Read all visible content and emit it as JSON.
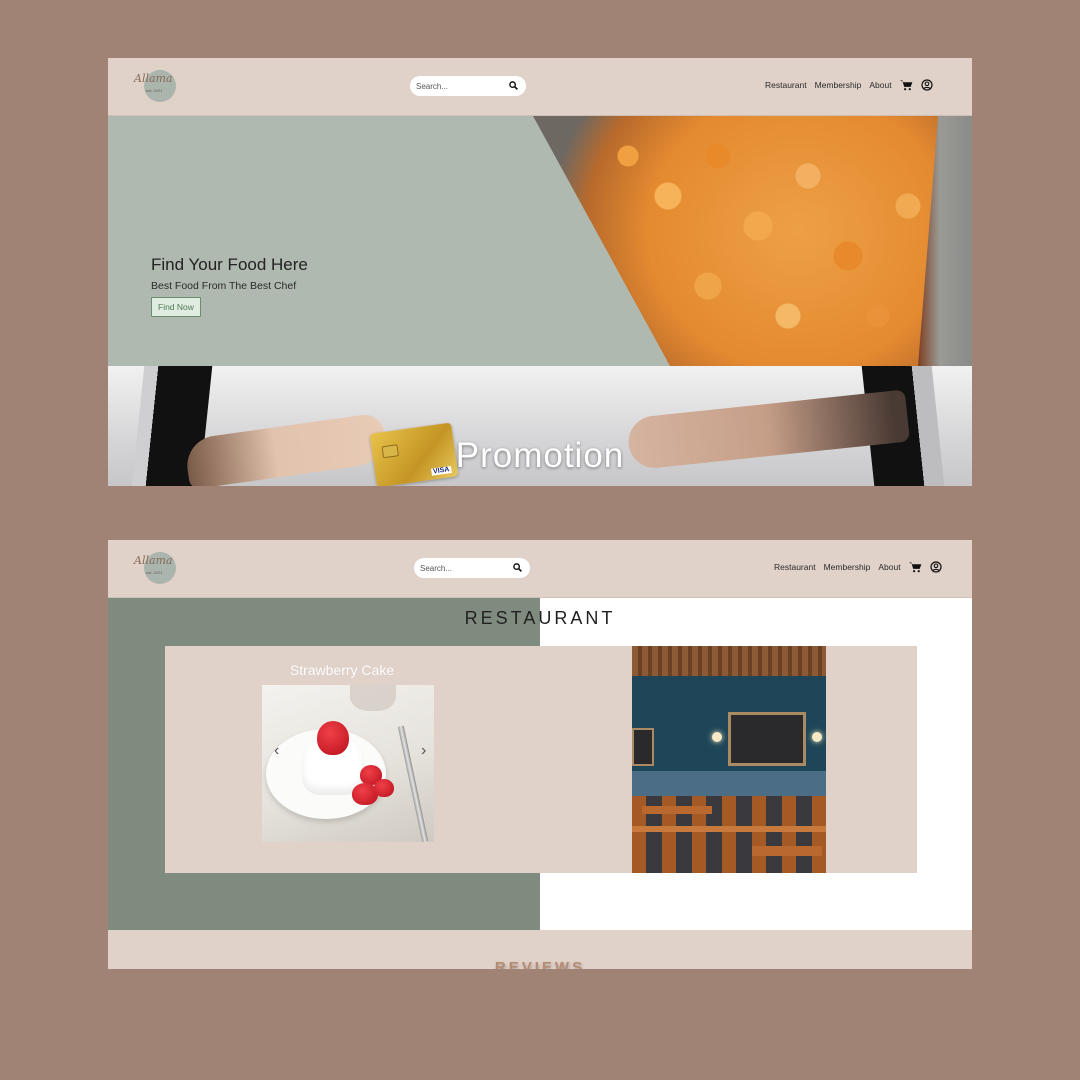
{
  "brand": {
    "logo_text": "Allama",
    "logo_sub": "est. 2021"
  },
  "search": {
    "placeholder": "Search..."
  },
  "nav": {
    "restaurant": "Restaurant",
    "membership": "Membership",
    "about": "About"
  },
  "icons": {
    "search": "search-icon",
    "cart": "cart-icon",
    "account": "user-circle-icon"
  },
  "hero": {
    "title": "Find Your Food Here",
    "subtitle": "Best Food From The Best Chef",
    "button": "Find Now"
  },
  "promo": {
    "title": "Promotion",
    "card_brand": "VISA"
  },
  "restaurant": {
    "title": "RESTAURANT",
    "slide_title": "Strawberry Cake",
    "prev_arrow": "‹",
    "next_arrow": "›"
  },
  "reviews": {
    "title": "REVIEWS"
  },
  "colors": {
    "background": "#a08374",
    "navbar": "#e1d2c9",
    "hero_bg": "#afb9b0",
    "section_green": "#808b80",
    "accent_button": "#4c7a52"
  }
}
